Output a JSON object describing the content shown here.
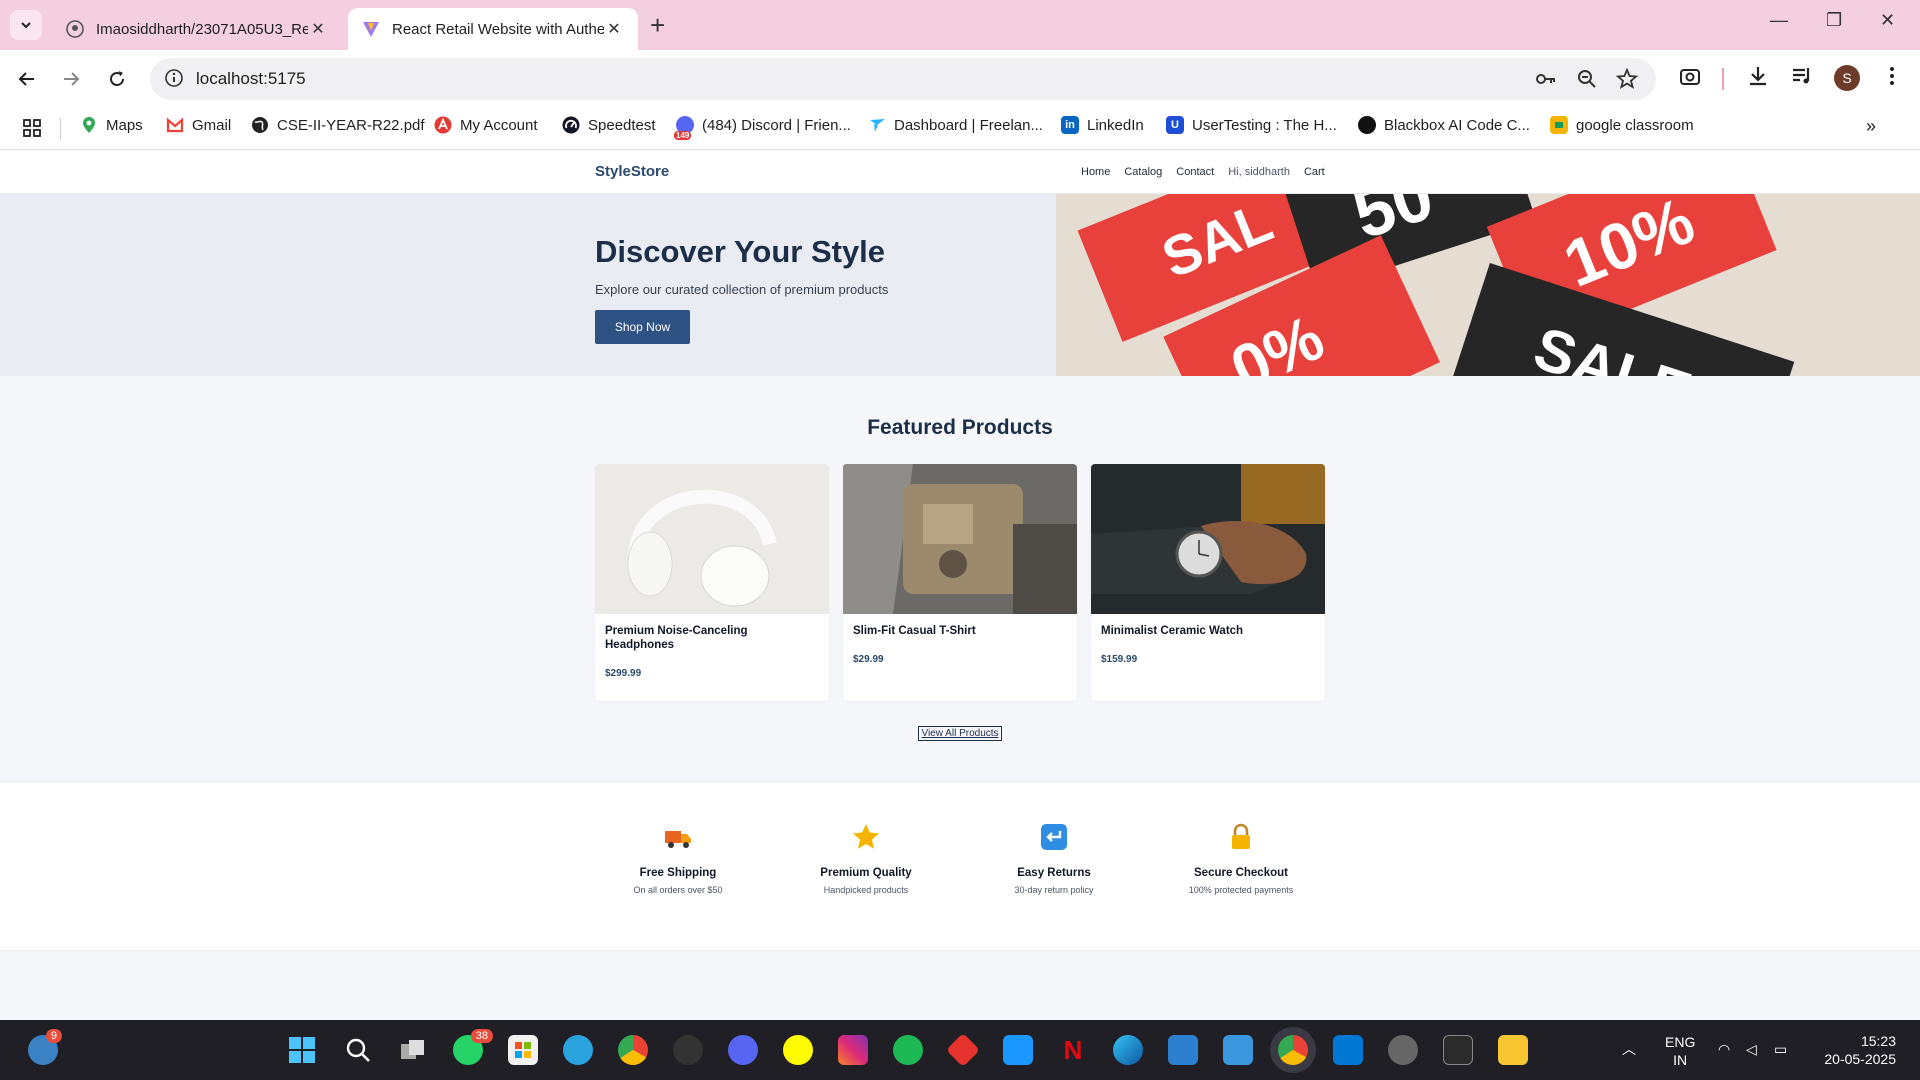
{
  "browser": {
    "tabs": [
      {
        "title": "Imaosiddharth/23071A05U3_Re",
        "active": false
      },
      {
        "title": "React Retail Website with Authe",
        "active": true
      }
    ],
    "url": "localhost:5175",
    "avatar_letter": "S",
    "bookmarks": [
      {
        "label": "Maps",
        "icon": "maps-icon",
        "color": "#34a853"
      },
      {
        "label": "Gmail",
        "icon": "gmail-icon",
        "color": "#ea4335"
      },
      {
        "label": "CSE-II-YEAR-R22.pdf",
        "icon": "globe-icon",
        "color": "#222222"
      },
      {
        "label": "My Account",
        "icon": "account-icon",
        "color": "#e53935"
      },
      {
        "label": "Speedtest",
        "icon": "speedtest-icon",
        "color": "#141526"
      },
      {
        "label": "(484) Discord | Frien...",
        "icon": "discord-icon",
        "color": "#5865f2"
      },
      {
        "label": "Dashboard | Freelan...",
        "icon": "freelancer-icon",
        "color": "#29b2fe"
      },
      {
        "label": "LinkedIn",
        "icon": "linkedin-icon",
        "color": "#0a66c2"
      },
      {
        "label": "UserTesting : The H...",
        "icon": "usertesting-icon",
        "color": "#1d4ed8"
      },
      {
        "label": "Blackbox AI Code C...",
        "icon": "blackbox-icon",
        "color": "#111111"
      },
      {
        "label": "google classroom",
        "icon": "classroom-icon",
        "color": "#f4b400"
      }
    ],
    "discord_badge": "149"
  },
  "site": {
    "brand": "StyleStore",
    "nav": [
      "Home",
      "Catalog",
      "Contact",
      "Hi, siddharth",
      "Cart"
    ],
    "hero": {
      "title": "Discover Your Style",
      "subtitle": "Explore our curated collection of premium products",
      "cta": "Shop Now",
      "image_text": [
        "SAL",
        "50",
        "10%",
        "0%",
        "SALE"
      ]
    },
    "featured_title": "Featured Products",
    "products": [
      {
        "name": "Premium Noise-Canceling Headphones",
        "price": "$299.99"
      },
      {
        "name": "Slim-Fit Casual T-Shirt",
        "price": "$29.99"
      },
      {
        "name": "Minimalist Ceramic Watch",
        "price": "$159.99"
      }
    ],
    "view_all": "View All Products",
    "features": [
      {
        "title": "Free Shipping",
        "desc": "On all orders over $50",
        "icon": "truck-icon"
      },
      {
        "title": "Premium Quality",
        "desc": "Handpicked products",
        "icon": "star-icon"
      },
      {
        "title": "Easy Returns",
        "desc": "30-day return policy",
        "icon": "return-icon"
      },
      {
        "title": "Secure Checkout",
        "desc": "100% protected payments",
        "icon": "lock-icon"
      }
    ]
  },
  "taskbar": {
    "weather_badge": "9",
    "whatsapp_badge": "38",
    "lang": "ENG",
    "region": "IN",
    "time": "15:23",
    "date": "20-05-2025"
  },
  "colors": {
    "tab_strip": "#f4cfdf",
    "brand": "#2c4a6e",
    "cta": "#2e5283",
    "hero_bg": "#e9edf3",
    "taskbar": "#1f1f25"
  }
}
